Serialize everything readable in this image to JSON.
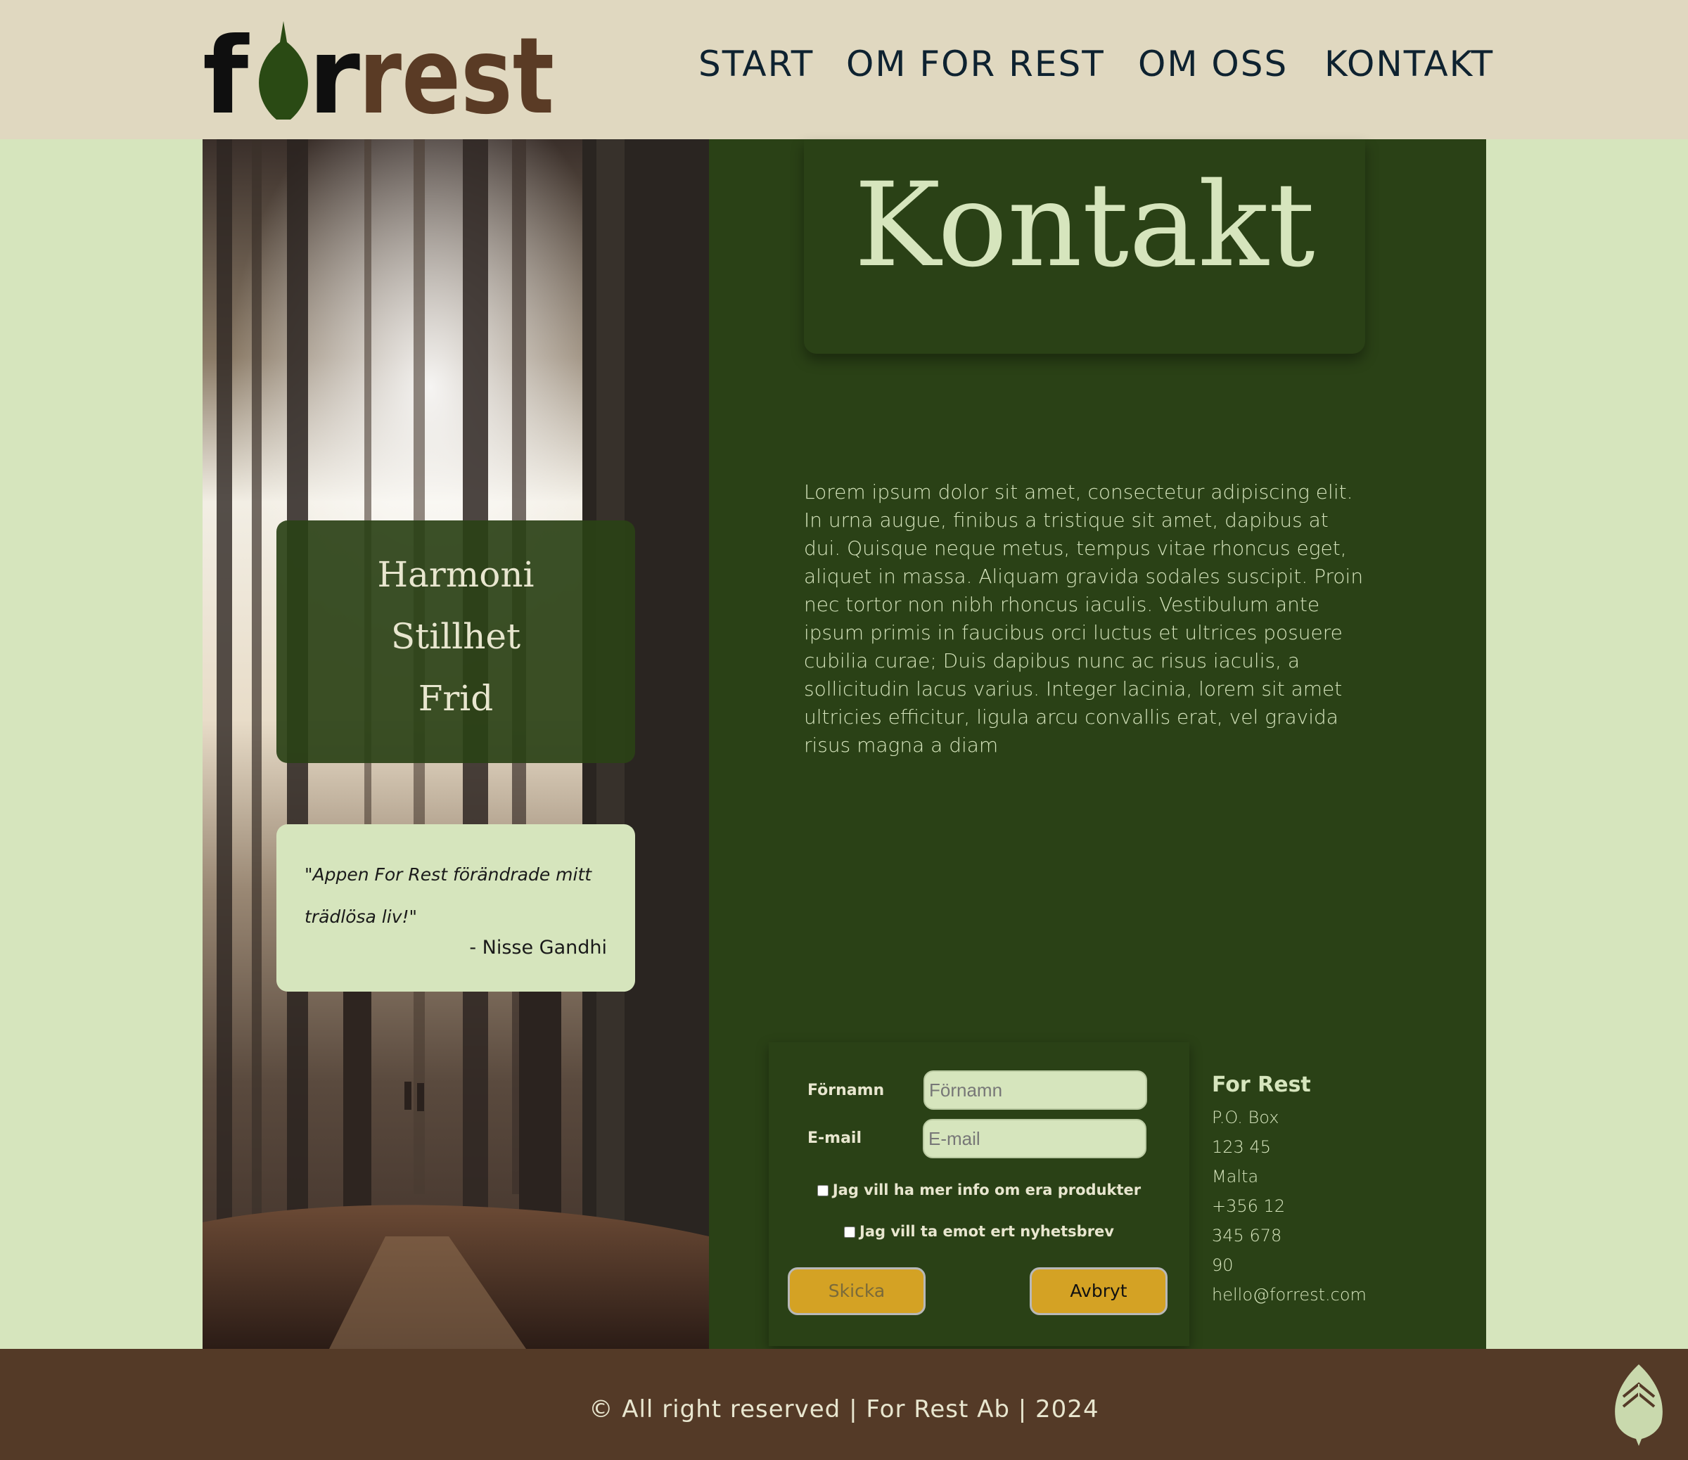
{
  "header": {
    "logo_text": "forrest",
    "nav": [
      "START",
      "OM FOR REST",
      "OM OSS",
      "KONTAKT"
    ]
  },
  "left": {
    "harmony": [
      "Harmoni",
      "Stillhet",
      "Frid"
    ],
    "quote": "\"Appen For Rest förändrade mitt trädlösa liv!\"",
    "quote_author": "- Nisse Gandhi"
  },
  "main": {
    "title": "Kontakt",
    "body": "Lorem ipsum dolor sit amet, consectetur adipiscing elit. In urna augue, finibus a tristique sit amet, dapibus at dui. Quisque neque metus, tempus vitae rhoncus eget, aliquet in massa. Aliquam gravida sodales suscipit. Proin nec tortor non nibh rhoncus iaculis. Vestibulum ante ipsum primis in faucibus orci luctus et ultrices posuere cubilia curae; Duis dapibus nunc ac risus iaculis, a sollicitudin lacus varius. Integer lacinia, lorem sit amet ultricies efficitur, ligula arcu convallis erat, vel gravida risus magna a diam"
  },
  "form": {
    "firstname_label": "Förnamn",
    "firstname_placeholder": "Förnamn",
    "firstname_value": "",
    "email_label": "E-mail",
    "email_placeholder": "E-mail",
    "email_value": "",
    "check_products": "Jag vill ha mer info om era produkter",
    "check_newsletter": "Jag vill ta emot ert nyhetsbrev",
    "submit_label": "Skicka",
    "cancel_label": "Avbryt"
  },
  "address": {
    "name": "For Rest",
    "lines": [
      "P.O. Box",
      "123 45",
      "Malta",
      "+356 12",
      "345 678",
      "90",
      "hello@forrest.com"
    ]
  },
  "footer": {
    "text": "© All right reserved | For Rest Ab | 2024"
  },
  "colors": {
    "header_bg": "#e0d8c0",
    "page_bg": "#d6e5bd",
    "content_green": "#2a4116",
    "footer_brown": "#543a27",
    "button_gold": "#d4a224"
  },
  "icons": [
    "leaf-logo-icon",
    "scroll-top-icon",
    "checkbox-icon"
  ]
}
